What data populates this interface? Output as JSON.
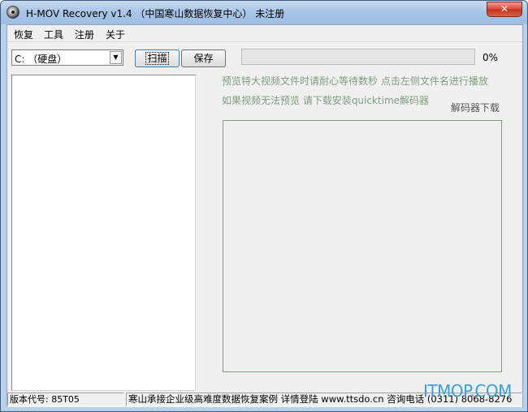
{
  "window": {
    "title": "H-MOV Recovery v1.4 （中国寒山数据恢复中心） 未注册",
    "close_label": "✕"
  },
  "menu": {
    "items": [
      "恢复",
      "工具",
      "注册",
      "关于"
    ]
  },
  "toolbar": {
    "drive_value": "C: （硬盘）",
    "drive_arrow": "▼",
    "scan_label": "扫描",
    "save_label": "保存",
    "progress_percent": "0%",
    "progress_fraction": 0
  },
  "hints": {
    "line1": "预览特大视频文件时请耐心等待数秒 点击左侧文件名进行播放",
    "line2": "如果视频无法预览 请下载安装quicktime解码器",
    "decoder_link": "解码器下载"
  },
  "status": {
    "version": "版本代号: 85T05",
    "info": "寒山承接企业级高难度数据恢复案例 详情登陆 www.ttsdo.cn 咨询电话 (0311) 8068-8276"
  },
  "watermark": "ITMOP.COM",
  "colors": {
    "title_gradient": "#a9c6e8",
    "close_button": "#c4301c",
    "hint_text": "#7f9f7f",
    "progress_fill": "#06b025",
    "watermark": "#3aa0d8"
  }
}
